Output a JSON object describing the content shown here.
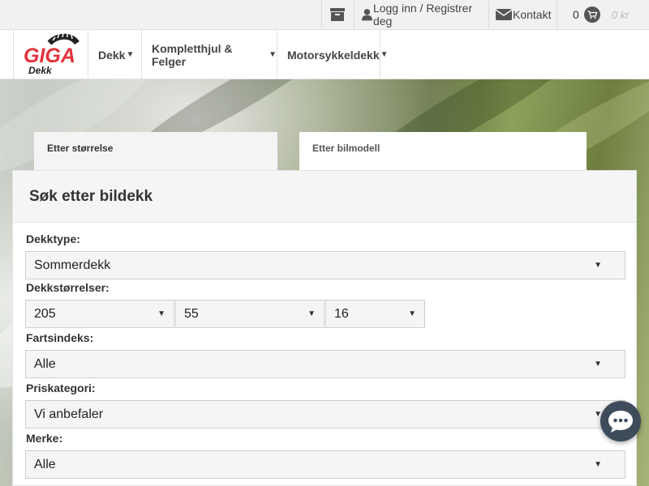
{
  "topbar": {
    "login_label": "Logg inn / Registrer deg",
    "contact_label": "Kontakt",
    "cart_count": "0",
    "cart_price": "0 kr"
  },
  "logo": {
    "brand": "GIGA",
    "sub": "Dekk"
  },
  "nav": {
    "items": [
      {
        "label": "Dekk"
      },
      {
        "label": "Kompletthjul & Felger"
      },
      {
        "label": "Motorsykkeldekk"
      }
    ]
  },
  "tabs": {
    "size": "Etter størrelse",
    "model": "Etter bilmodell"
  },
  "search": {
    "title": "Søk etter bildekk",
    "tire_type_label": "Dekktype:",
    "tire_type_value": "Sommerdekk",
    "sizes_label": "Dekkstørrelser:",
    "width_value": "205",
    "profile_value": "55",
    "rim_value": "16",
    "speed_label": "Fartsindeks:",
    "speed_value": "Alle",
    "price_label": "Priskategori:",
    "price_value": "Vi anbefaler",
    "brand_label": "Merke:",
    "brand_value": "Alle"
  },
  "colors": {
    "logo_red": "#e3323b",
    "chat_bg": "#3d4b5a"
  }
}
